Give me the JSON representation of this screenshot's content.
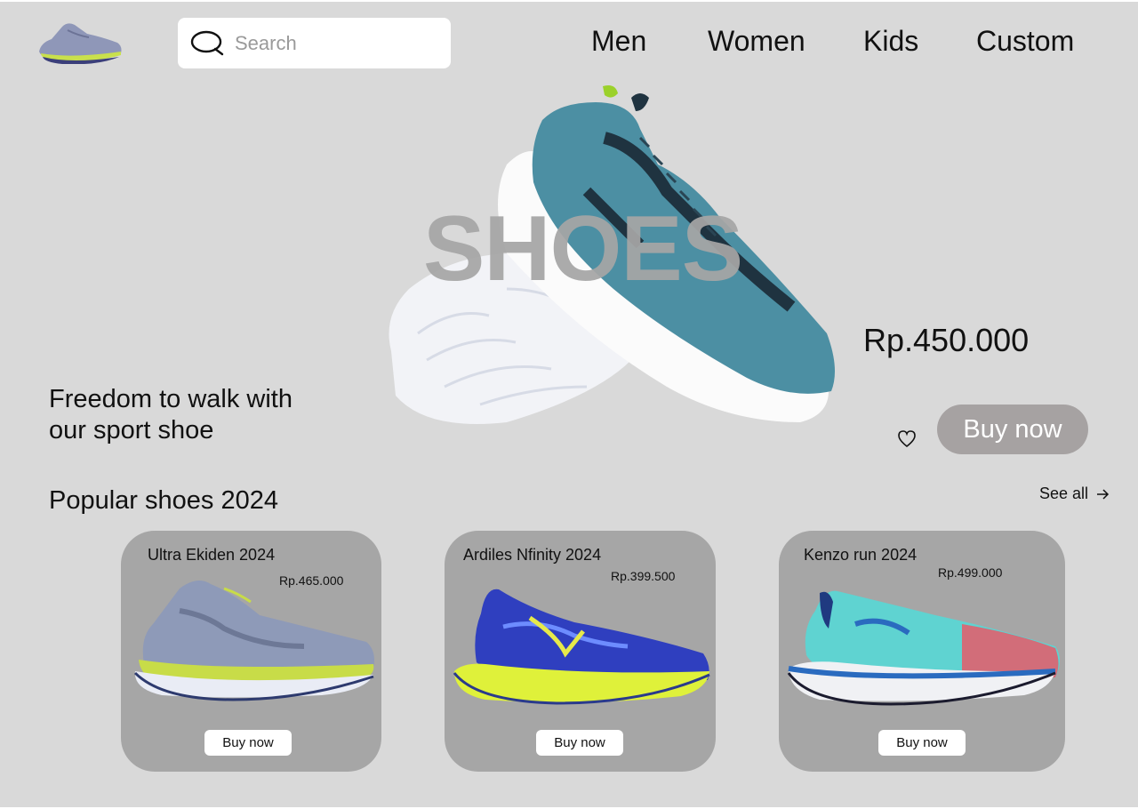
{
  "header": {
    "search_placeholder": "Search",
    "nav": [
      "Men",
      "Women",
      "Kids",
      "Custom"
    ]
  },
  "hero": {
    "title": "SHOES",
    "tagline_line1": "Freedom to walk with",
    "tagline_line2": "our sport shoe",
    "price": "Rp.450.000",
    "buy_label": "Buy now"
  },
  "popular": {
    "title": "Popular shoes 2024",
    "see_all": "See all",
    "products": [
      {
        "name": "Ultra Ekiden 2024",
        "price": "Rp.465.000",
        "buy_label": "Buy now"
      },
      {
        "name": "Ardiles Nfinity 2024",
        "price": "Rp.399.500",
        "buy_label": "Buy now"
      },
      {
        "name": "Kenzo run 2024",
        "price": "Rp.499.000",
        "buy_label": "Buy now"
      }
    ]
  },
  "colors": {
    "background": "#d9d9d9",
    "card": "#a6a6a6",
    "hero_button": "#a6a2a2",
    "hero_title": "#a6a6a6"
  },
  "icons": [
    "logo-shoe-icon",
    "search-icon",
    "heart-icon",
    "arrow-right-icon"
  ]
}
